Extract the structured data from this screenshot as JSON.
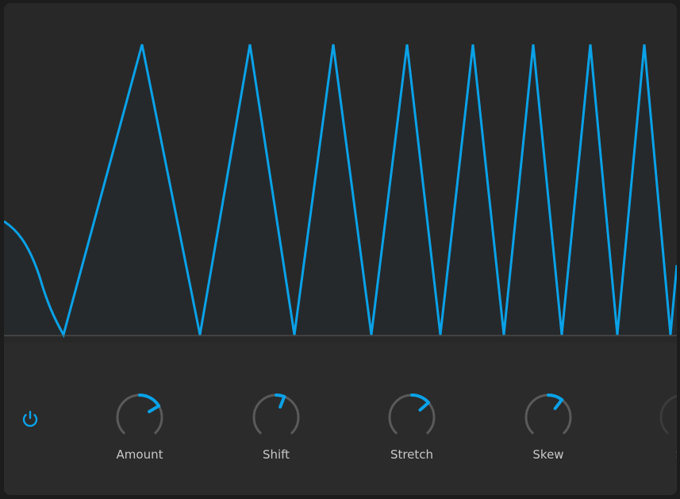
{
  "colors": {
    "accent": "#0aa2e8",
    "fill": "#25292c",
    "track": "#5a5a5a",
    "label": "#c7c7c7"
  },
  "power": {
    "icon": "power-icon",
    "state": "on"
  },
  "knobs": [
    {
      "label": "Amount",
      "value": 0.72
    },
    {
      "label": "Shift",
      "value": 0.58
    },
    {
      "label": "Stretch",
      "value": 0.68
    },
    {
      "label": "Skew",
      "value": 0.64
    },
    {
      "label": "Sp",
      "value": 0.5
    }
  ]
}
